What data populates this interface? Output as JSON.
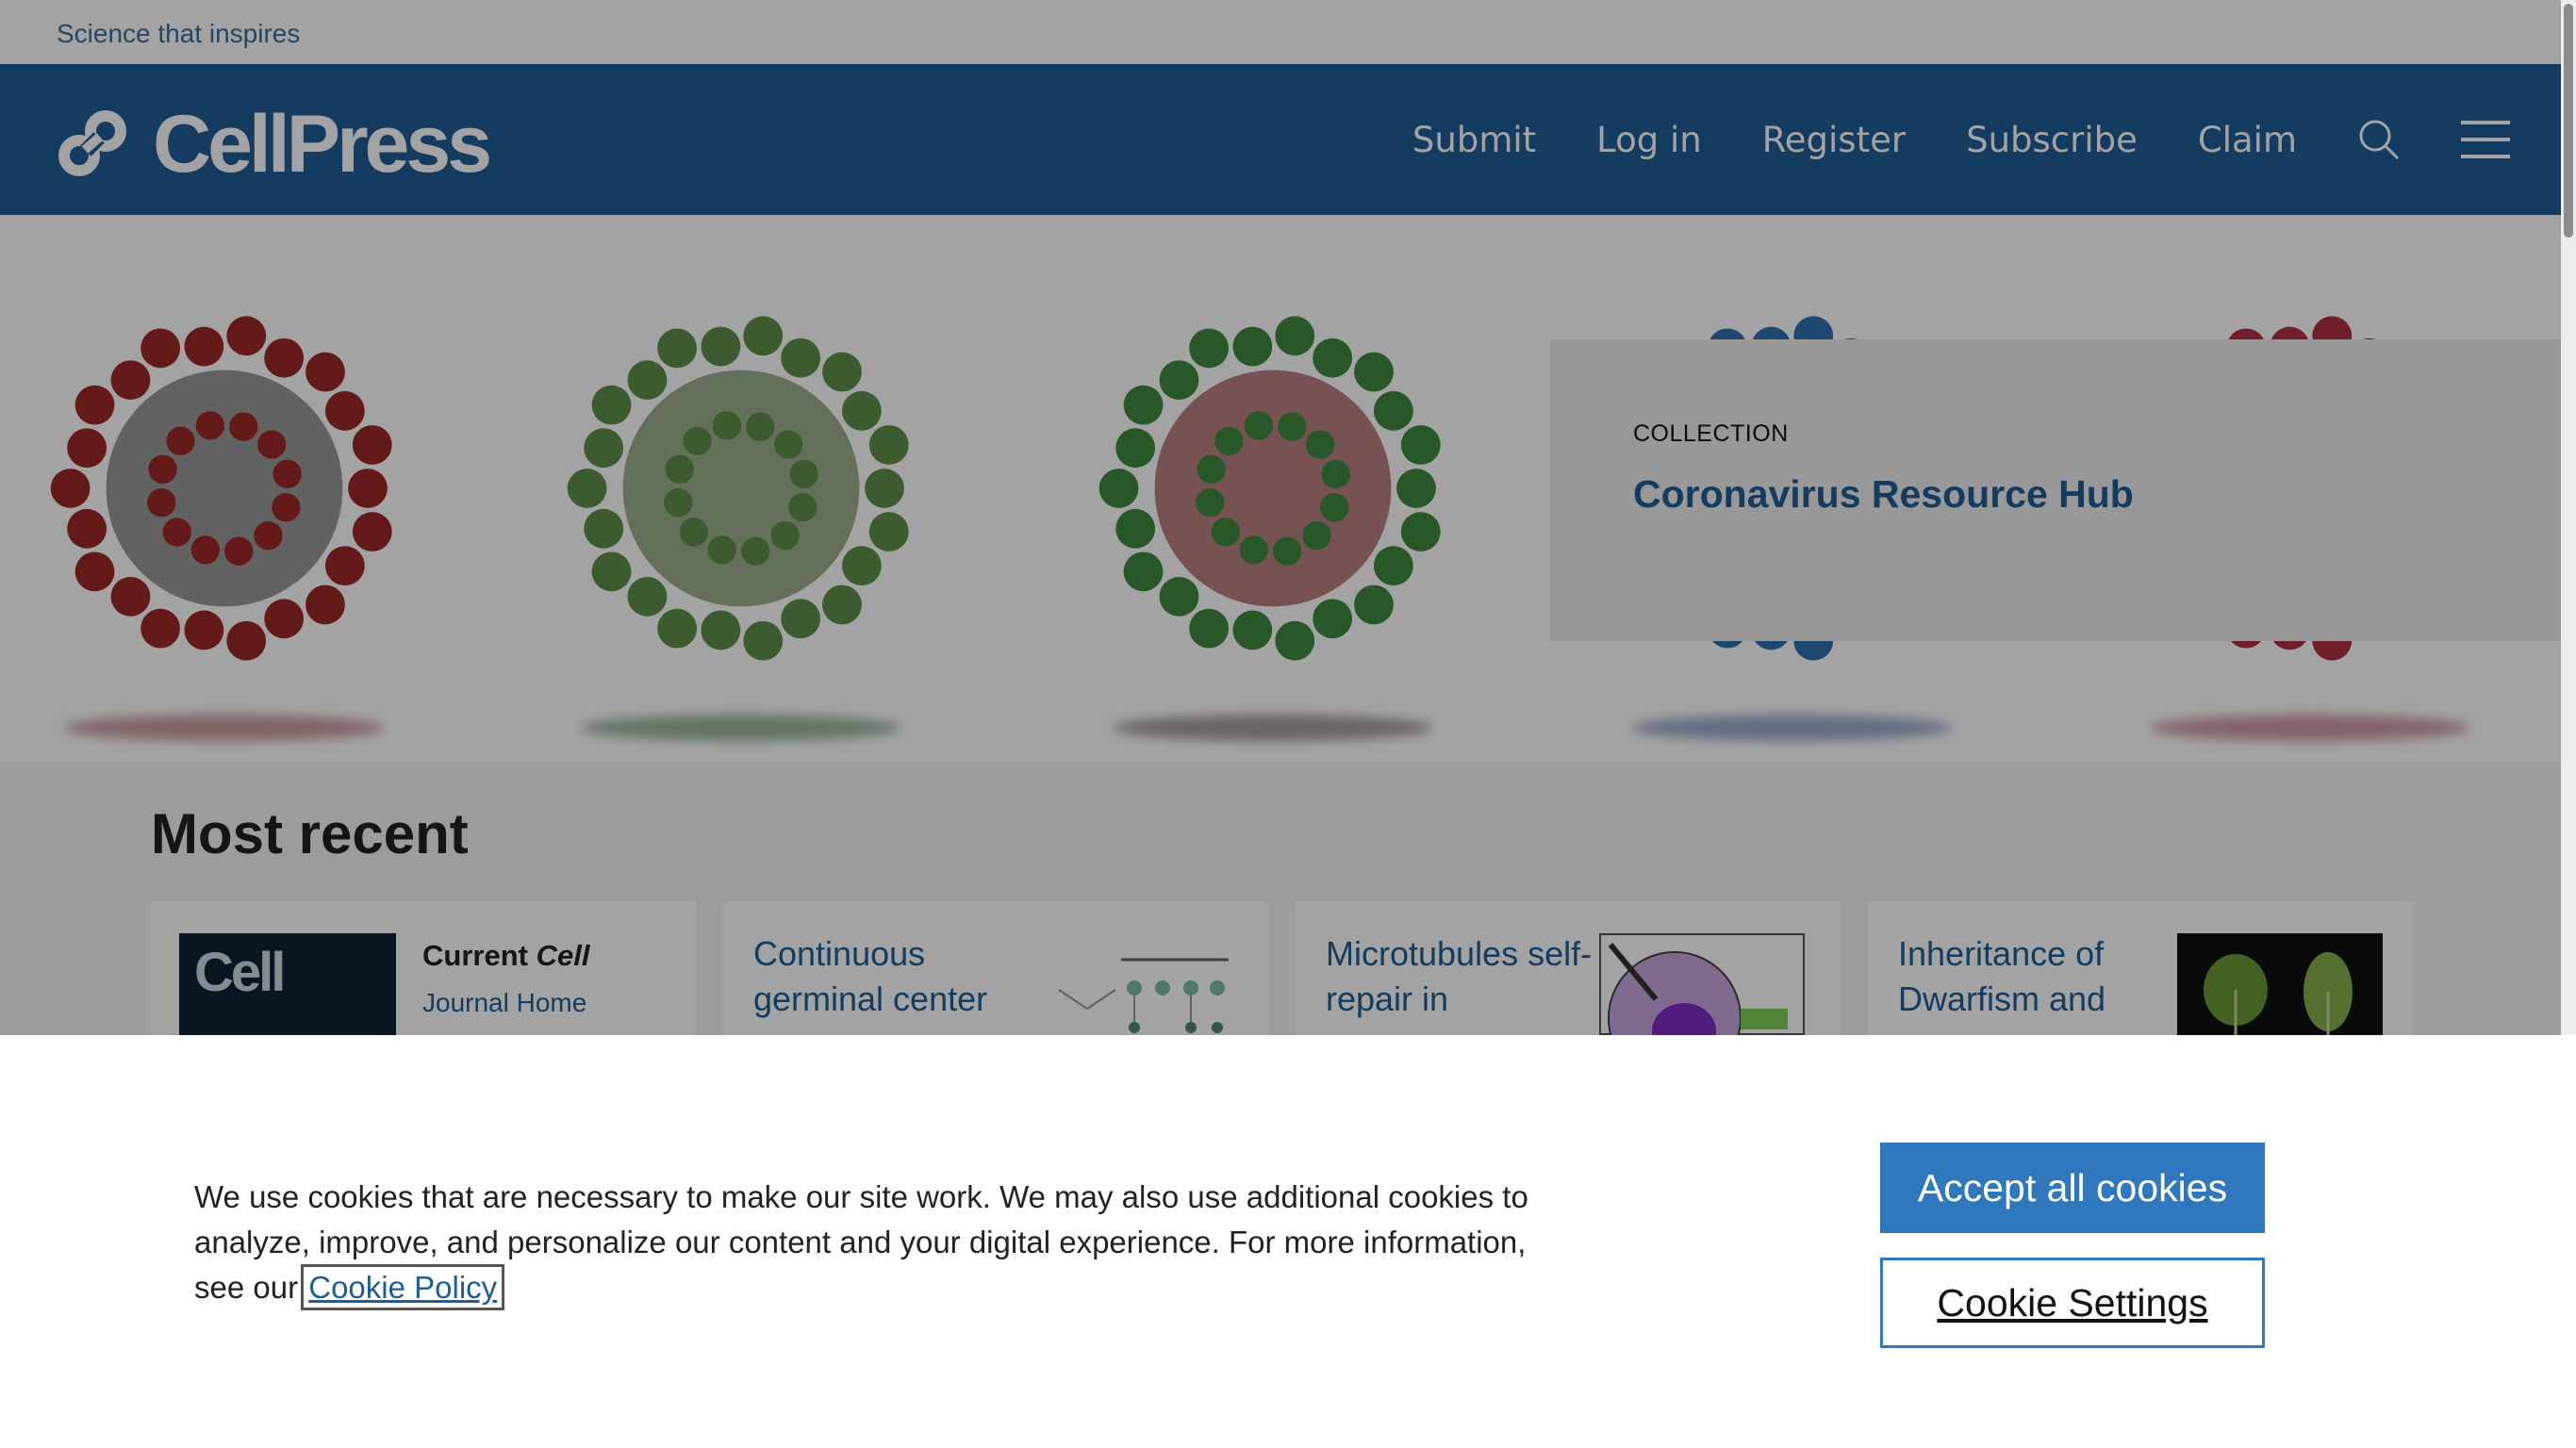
{
  "topbar": {
    "tagline": "Science that inspires"
  },
  "header": {
    "logo_text": "CellPress",
    "nav": [
      "Submit",
      "Log in",
      "Register",
      "Subscribe",
      "Claim"
    ],
    "search_icon": "search-icon",
    "menu_icon": "hamburger-menu-icon",
    "brand_color": "#1e5e96"
  },
  "hero": {
    "collection_label": "COLLECTION",
    "collection_title": "Coronavirus Resource Hub",
    "virus_colors": [
      "#9e2a2a",
      "#5f8f4a",
      "#3f8a3f",
      "#2f6fb0",
      "#b03040"
    ]
  },
  "recent": {
    "heading": "Most recent",
    "current_label": "Current",
    "current_journal": "Cell",
    "journal_home": "Journal Home",
    "cover_word": "Cell",
    "cards": [
      {
        "title": "Continuous germinal center"
      },
      {
        "title": "Microtubules self-repair in"
      },
      {
        "title": "Inheritance of Dwarfism and"
      }
    ]
  },
  "cookie": {
    "text": "We use cookies that are necessary to make our site work. We may also use additional cookies to analyze, improve, and personalize our content and your digital experience. For more information, see our",
    "link": "Cookie Policy",
    "accept": "Accept all cookies",
    "settings": "Cookie Settings",
    "accent_color": "#2f78bd"
  }
}
